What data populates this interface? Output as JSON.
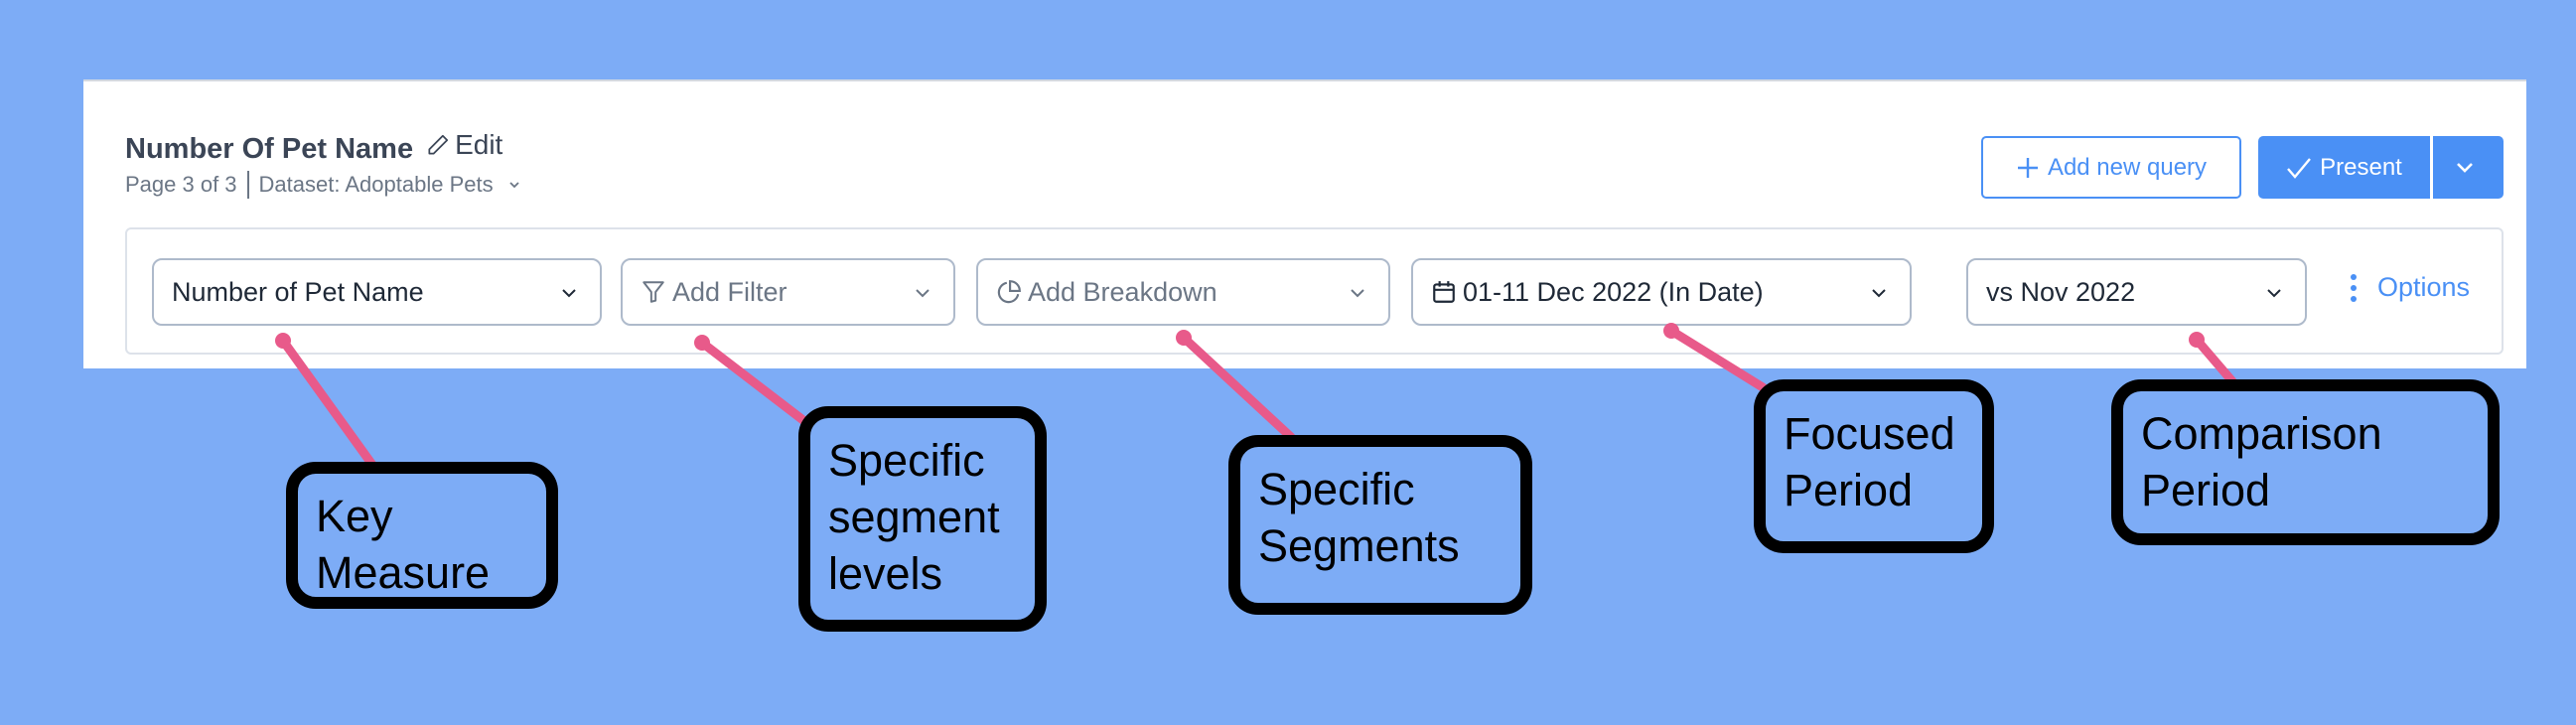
{
  "header": {
    "title": "Number Of Pet Name",
    "edit_label": "Edit",
    "page_info": "Page 3 of 3",
    "dataset_label": "Dataset: Adoptable Pets"
  },
  "toolbar": {
    "add_query_label": "Add new query",
    "present_label": "Present"
  },
  "query_bar": {
    "measure": {
      "value": "Number of Pet Name"
    },
    "filter": {
      "placeholder": "Add Filter"
    },
    "breakdown": {
      "placeholder": "Add Breakdown"
    },
    "date_range": {
      "value": "01-11 Dec 2022 (In Date)"
    },
    "comparison": {
      "value": "vs Nov 2022"
    },
    "options_label": "Options"
  },
  "callouts": [
    {
      "text": "Key Measure"
    },
    {
      "text": "Specific segment levels"
    },
    {
      "text": "Specific Segments"
    },
    {
      "text": "Focused Period"
    },
    {
      "text": "Comparison Period"
    }
  ],
  "colors": {
    "background": "#7dacf6",
    "accent": "#4a90f5",
    "callout_line": "#e85a8a",
    "callout_border": "#000000"
  }
}
